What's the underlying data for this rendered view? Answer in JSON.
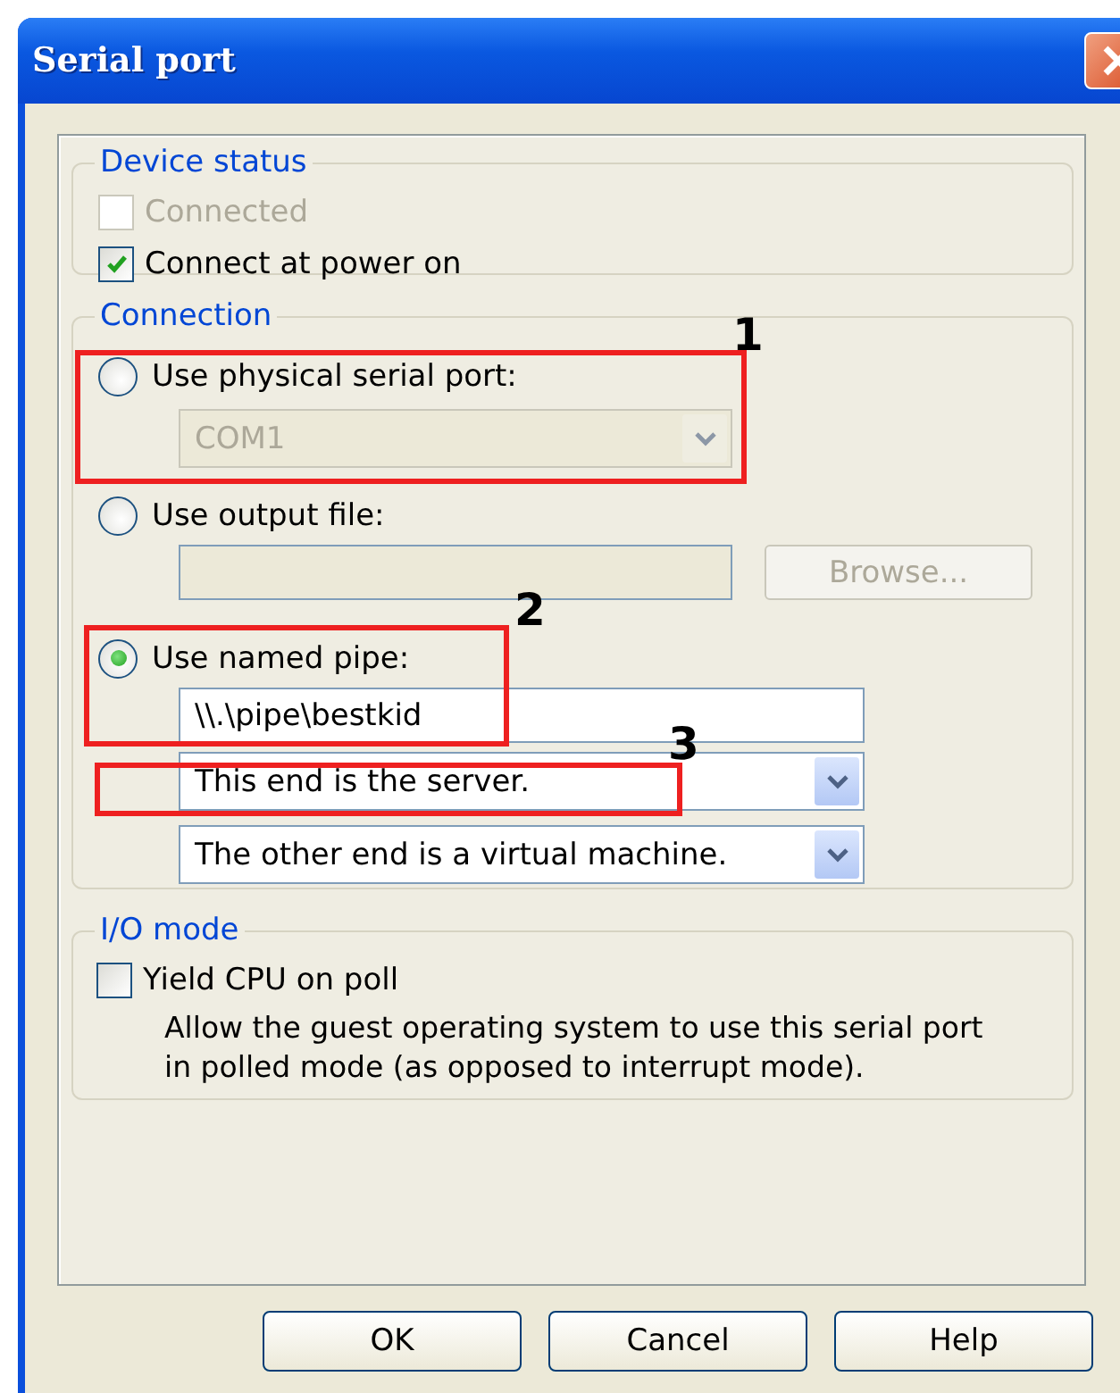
{
  "window": {
    "title": "Serial port"
  },
  "device_status": {
    "legend": "Device status",
    "options": [
      {
        "label": "Connected",
        "checked": false,
        "disabled": true
      },
      {
        "label": "Connect at power on",
        "checked": true,
        "disabled": false
      }
    ]
  },
  "connection": {
    "legend": "Connection",
    "options": [
      {
        "kind": "combo",
        "label": "Use physical serial port:",
        "selected": false,
        "disabled": true,
        "value": "COM1"
      },
      {
        "kind": "file",
        "label": "Use output file:",
        "selected": false,
        "disabled": true,
        "button": "Browse..."
      },
      {
        "kind": "pipe",
        "label": "Use named pipe:",
        "selected": true,
        "value": "\\\\.\\pipe\\bestkid",
        "combos": [
          "This end is the server.",
          "The other end is a virtual machine."
        ]
      }
    ]
  },
  "io_mode": {
    "legend": "I/O mode",
    "option": {
      "label": "Yield CPU on poll",
      "checked": false,
      "disabled": false
    },
    "description": "Allow the guest operating system to use this serial port in polled mode (as opposed to interrupt mode)."
  },
  "buttons": [
    "OK",
    "Cancel",
    "Help"
  ],
  "annotations": [
    {
      "label": "1"
    },
    {
      "label": "2"
    },
    {
      "label": "3"
    }
  ]
}
